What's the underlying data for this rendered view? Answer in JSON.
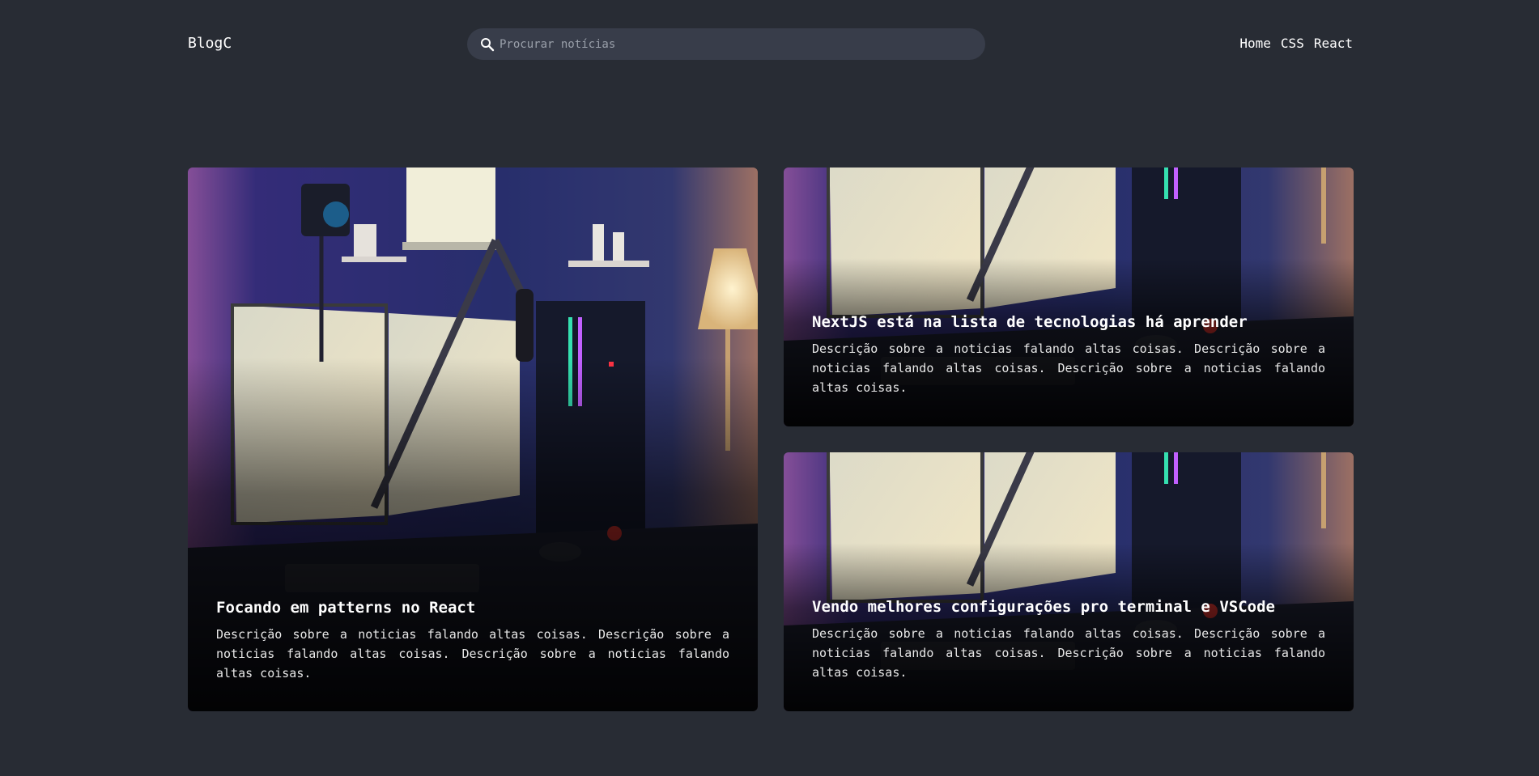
{
  "header": {
    "logo": "BlogC",
    "search": {
      "placeholder": "Procurar notícias",
      "value": ""
    },
    "nav": [
      "Home",
      "CSS",
      "React"
    ]
  },
  "posts": [
    {
      "title": "Focando em patterns no React",
      "description": "Descrição sobre a noticias falando altas coisas. Descrição sobre a noticias falando altas coisas. Descrição sobre a noticias falando altas coisas."
    },
    {
      "title": "NextJS está na lista de tecnologias há aprender",
      "description": "Descrição sobre a noticias falando altas coisas. Descrição sobre a noticias falando altas coisas. Descrição sobre a noticias falando altas coisas."
    },
    {
      "title": "Vendo melhores configurações pro terminal e VSCode",
      "description": "Descrição sobre a noticias falando altas coisas. Descrição sobre a noticias falando altas coisas. Descrição sobre a noticias falando altas coisas."
    }
  ],
  "colors": {
    "background": "#282c34",
    "search_bg": "#383d4a",
    "text": "#ffffff"
  },
  "icons": {
    "search": "search-icon"
  }
}
